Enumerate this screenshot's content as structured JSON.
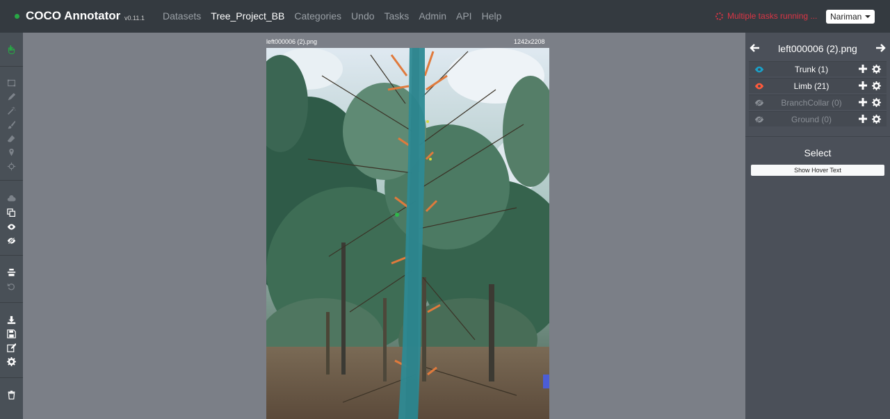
{
  "navbar": {
    "brand": "COCO Annotator",
    "version": "v0.11.1",
    "links": [
      "Datasets",
      "Tree_Project_BB",
      "Categories",
      "Undo",
      "Tasks",
      "Admin",
      "API",
      "Help"
    ],
    "tasks_status": "Multiple tasks running ...",
    "user": "Nariman"
  },
  "toolbar": {
    "icons": [
      "select-hand-icon",
      "bbox-icon",
      "polygon-icon",
      "magic-wand-icon",
      "brush-icon",
      "eraser-icon",
      "keypoint-icon",
      "dextr-icon",
      "cloud-download-icon",
      "copy-annotations-icon",
      "show-all-icon",
      "hide-all-icon",
      "center-image-icon",
      "undo-icon",
      "download-icon",
      "save-icon",
      "mode-icon",
      "settings-icon",
      "delete-icon"
    ]
  },
  "canvas": {
    "image_name": "left000006 (2).png",
    "image_size": "1242x2208"
  },
  "panel": {
    "file_name": "left000006 (2).png",
    "categories": [
      {
        "label": "Trunk (1)",
        "visible": true,
        "color": "#1aa0c8"
      },
      {
        "label": "Limb (21)",
        "visible": true,
        "color": "#ff5a3c"
      },
      {
        "label": "BranchCollar (0)",
        "visible": false,
        "color": "#8a8f96"
      },
      {
        "label": "Ground (0)",
        "visible": false,
        "color": "#8a8f96"
      }
    ],
    "select_title": "Select",
    "hover_button": "Show Hover Text"
  }
}
